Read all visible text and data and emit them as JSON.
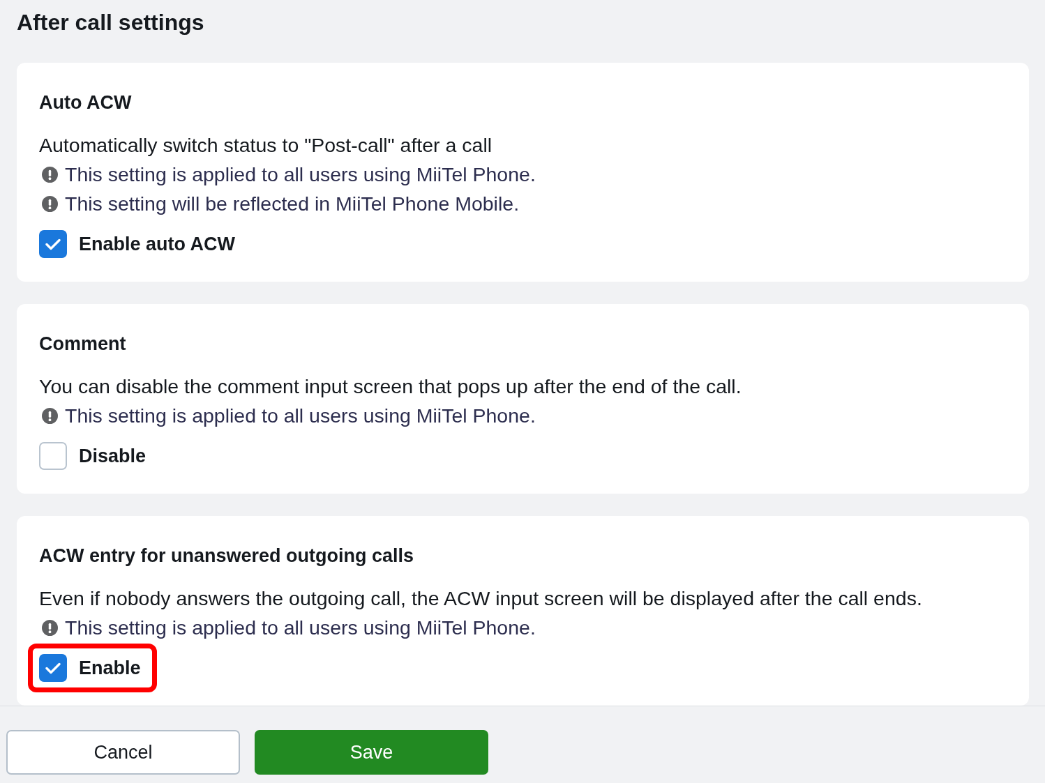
{
  "page_title": "After call settings",
  "sections": [
    {
      "title": "Auto ACW",
      "description": "Automatically switch status to \"Post-call\" after a call",
      "notes": [
        "This setting is applied to all users using MiiTel Phone.",
        "This setting will be reflected in MiiTel Phone Mobile."
      ],
      "option": {
        "label": "Enable auto ACW",
        "checked": true,
        "highlighted": false
      }
    },
    {
      "title": "Comment",
      "description": "You can disable the comment input screen that pops up after the end of the call.",
      "notes": [
        "This setting is applied to all users using MiiTel Phone."
      ],
      "option": {
        "label": "Disable",
        "checked": false,
        "highlighted": false
      }
    },
    {
      "title": "ACW entry for unanswered outgoing calls",
      "description": "Even if nobody answers the outgoing call, the ACW input screen will be displayed after the call ends.",
      "notes": [
        "This setting is applied to all users using MiiTel Phone."
      ],
      "option": {
        "label": "Enable",
        "checked": true,
        "highlighted": true
      }
    }
  ],
  "buttons": [
    {
      "label": "Cancel",
      "kind": "secondary"
    },
    {
      "label": "Save",
      "kind": "primary"
    }
  ]
}
